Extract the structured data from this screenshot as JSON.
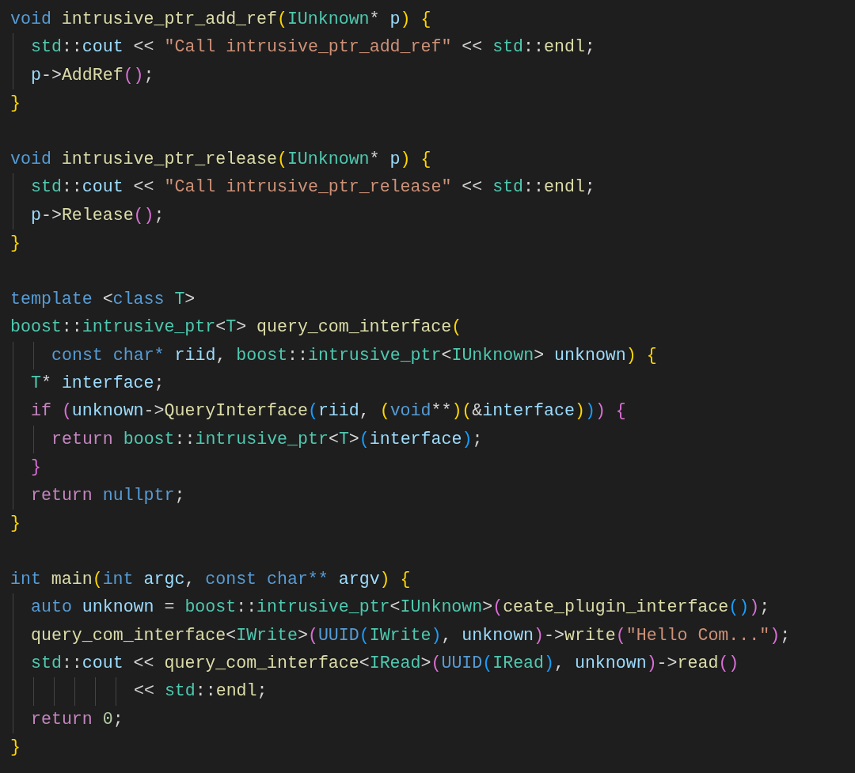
{
  "editor": {
    "lines": [
      {
        "kind": "code",
        "tokens": [
          {
            "text": "void ",
            "kind": "kw"
          },
          {
            "text": "intrusive_ptr_add_ref",
            "kind": "fn"
          },
          {
            "text": "(",
            "kind": "b1"
          },
          {
            "text": "IUnknown",
            "kind": "type"
          },
          {
            "text": "* ",
            "kind": "p"
          },
          {
            "text": "p",
            "kind": "var"
          },
          {
            "text": ") ",
            "kind": "b1"
          },
          {
            "text": "{",
            "kind": "b1"
          }
        ],
        "children": [
          {
            "kind": "code",
            "tokens": [
              {
                "text": "std",
                "kind": "type"
              },
              {
                "text": "::",
                "kind": "p"
              },
              {
                "text": "cout ",
                "kind": "var"
              },
              {
                "text": "<< ",
                "kind": "p"
              },
              {
                "text": "\"Call intrusive_ptr_add_ref\" ",
                "kind": "str"
              },
              {
                "text": "<< ",
                "kind": "p"
              },
              {
                "text": "std",
                "kind": "type"
              },
              {
                "text": "::",
                "kind": "p"
              },
              {
                "text": "endl",
                "kind": "fn"
              },
              {
                "text": ";",
                "kind": "p"
              }
            ]
          },
          {
            "kind": "code",
            "tokens": [
              {
                "text": "p",
                "kind": "var"
              },
              {
                "text": "->",
                "kind": "p"
              },
              {
                "text": "AddRef",
                "kind": "fn"
              },
              {
                "text": "()",
                "kind": "b2"
              },
              {
                "text": ";",
                "kind": "p"
              }
            ]
          }
        ]
      },
      {
        "kind": "code",
        "tokens": [
          {
            "text": "}",
            "kind": "b1"
          }
        ]
      },
      {
        "kind": "blank"
      },
      {
        "kind": "code",
        "tokens": [
          {
            "text": "void ",
            "kind": "kw"
          },
          {
            "text": "intrusive_ptr_release",
            "kind": "fn"
          },
          {
            "text": "(",
            "kind": "b1"
          },
          {
            "text": "IUnknown",
            "kind": "type"
          },
          {
            "text": "* ",
            "kind": "p"
          },
          {
            "text": "p",
            "kind": "var"
          },
          {
            "text": ") ",
            "kind": "b1"
          },
          {
            "text": "{",
            "kind": "b1"
          }
        ],
        "children": [
          {
            "kind": "code",
            "tokens": [
              {
                "text": "std",
                "kind": "type"
              },
              {
                "text": "::",
                "kind": "p"
              },
              {
                "text": "cout ",
                "kind": "var"
              },
              {
                "text": "<< ",
                "kind": "p"
              },
              {
                "text": "\"Call intrusive_ptr_release\" ",
                "kind": "str"
              },
              {
                "text": "<< ",
                "kind": "p"
              },
              {
                "text": "std",
                "kind": "type"
              },
              {
                "text": "::",
                "kind": "p"
              },
              {
                "text": "endl",
                "kind": "fn"
              },
              {
                "text": ";",
                "kind": "p"
              }
            ]
          },
          {
            "kind": "code",
            "tokens": [
              {
                "text": "p",
                "kind": "var"
              },
              {
                "text": "->",
                "kind": "p"
              },
              {
                "text": "Release",
                "kind": "fn"
              },
              {
                "text": "()",
                "kind": "b2"
              },
              {
                "text": ";",
                "kind": "p"
              }
            ]
          }
        ]
      },
      {
        "kind": "code",
        "tokens": [
          {
            "text": "}",
            "kind": "b1"
          }
        ]
      },
      {
        "kind": "blank"
      },
      {
        "kind": "code",
        "tokens": [
          {
            "text": "template ",
            "kind": "kw"
          },
          {
            "text": "<",
            "kind": "p"
          },
          {
            "text": "class ",
            "kind": "kw"
          },
          {
            "text": "T",
            "kind": "type"
          },
          {
            "text": ">",
            "kind": "p"
          }
        ]
      },
      {
        "kind": "code",
        "tokens": [
          {
            "text": "boost",
            "kind": "type"
          },
          {
            "text": "::",
            "kind": "p"
          },
          {
            "text": "intrusive_ptr",
            "kind": "type"
          },
          {
            "text": "<",
            "kind": "p"
          },
          {
            "text": "T",
            "kind": "type"
          },
          {
            "text": "> ",
            "kind": "p"
          },
          {
            "text": "query_com_interface",
            "kind": "fn"
          },
          {
            "text": "(",
            "kind": "b1"
          }
        ],
        "children": [
          {
            "kind": "group",
            "children": [
              {
                "kind": "code",
                "tokens": [
                  {
                    "text": "const ",
                    "kind": "kw"
                  },
                  {
                    "text": "char* ",
                    "kind": "kw"
                  },
                  {
                    "text": "riid",
                    "kind": "var"
                  },
                  {
                    "text": ", ",
                    "kind": "p"
                  },
                  {
                    "text": "boost",
                    "kind": "type"
                  },
                  {
                    "text": "::",
                    "kind": "p"
                  },
                  {
                    "text": "intrusive_ptr",
                    "kind": "type"
                  },
                  {
                    "text": "<",
                    "kind": "p"
                  },
                  {
                    "text": "IUnknown",
                    "kind": "type"
                  },
                  {
                    "text": "> ",
                    "kind": "p"
                  },
                  {
                    "text": "unknown",
                    "kind": "var"
                  },
                  {
                    "text": ") ",
                    "kind": "b1"
                  },
                  {
                    "text": "{",
                    "kind": "b1"
                  }
                ]
              }
            ]
          },
          {
            "kind": "code",
            "tokens": [
              {
                "text": "T",
                "kind": "type"
              },
              {
                "text": "* ",
                "kind": "p"
              },
              {
                "text": "interface",
                "kind": "var"
              },
              {
                "text": ";",
                "kind": "p"
              }
            ]
          },
          {
            "kind": "code",
            "tokens": [
              {
                "text": "if ",
                "kind": "ctl"
              },
              {
                "text": "(",
                "kind": "b2"
              },
              {
                "text": "unknown",
                "kind": "var"
              },
              {
                "text": "->",
                "kind": "p"
              },
              {
                "text": "QueryInterface",
                "kind": "fn"
              },
              {
                "text": "(",
                "kind": "b3"
              },
              {
                "text": "riid",
                "kind": "var"
              },
              {
                "text": ", ",
                "kind": "p"
              },
              {
                "text": "(",
                "kind": "b1"
              },
              {
                "text": "void",
                "kind": "kw"
              },
              {
                "text": "**",
                "kind": "p"
              },
              {
                "text": ")",
                "kind": "b1"
              },
              {
                "text": "(",
                "kind": "b1"
              },
              {
                "text": "&",
                "kind": "p"
              },
              {
                "text": "interface",
                "kind": "var"
              },
              {
                "text": ")",
                "kind": "b1"
              },
              {
                "text": ")",
                "kind": "b3"
              },
              {
                "text": ") ",
                "kind": "b2"
              },
              {
                "text": "{",
                "kind": "b2"
              }
            ],
            "children": [
              {
                "kind": "code",
                "tokens": [
                  {
                    "text": "return ",
                    "kind": "ctl"
                  },
                  {
                    "text": "boost",
                    "kind": "type"
                  },
                  {
                    "text": "::",
                    "kind": "p"
                  },
                  {
                    "text": "intrusive_ptr",
                    "kind": "type"
                  },
                  {
                    "text": "<",
                    "kind": "p"
                  },
                  {
                    "text": "T",
                    "kind": "type"
                  },
                  {
                    "text": ">",
                    "kind": "p"
                  },
                  {
                    "text": "(",
                    "kind": "b3"
                  },
                  {
                    "text": "interface",
                    "kind": "var"
                  },
                  {
                    "text": ")",
                    "kind": "b3"
                  },
                  {
                    "text": ";",
                    "kind": "p"
                  }
                ]
              }
            ]
          },
          {
            "kind": "code",
            "tokens": [
              {
                "text": "}",
                "kind": "b2"
              }
            ]
          },
          {
            "kind": "code",
            "tokens": [
              {
                "text": "return ",
                "kind": "ctl"
              },
              {
                "text": "nullptr",
                "kind": "kw"
              },
              {
                "text": ";",
                "kind": "p"
              }
            ]
          }
        ]
      },
      {
        "kind": "code",
        "tokens": [
          {
            "text": "}",
            "kind": "b1"
          }
        ]
      },
      {
        "kind": "blank"
      },
      {
        "kind": "code",
        "tokens": [
          {
            "text": "int ",
            "kind": "kw"
          },
          {
            "text": "main",
            "kind": "fn"
          },
          {
            "text": "(",
            "kind": "b1"
          },
          {
            "text": "int ",
            "kind": "kw"
          },
          {
            "text": "argc",
            "kind": "var"
          },
          {
            "text": ", ",
            "kind": "p"
          },
          {
            "text": "const ",
            "kind": "kw"
          },
          {
            "text": "char** ",
            "kind": "kw"
          },
          {
            "text": "argv",
            "kind": "var"
          },
          {
            "text": ") ",
            "kind": "b1"
          },
          {
            "text": "{",
            "kind": "b1"
          }
        ],
        "children": [
          {
            "kind": "code",
            "tokens": [
              {
                "text": "auto ",
                "kind": "kw"
              },
              {
                "text": "unknown ",
                "kind": "var"
              },
              {
                "text": "= ",
                "kind": "p"
              },
              {
                "text": "boost",
                "kind": "type"
              },
              {
                "text": "::",
                "kind": "p"
              },
              {
                "text": "intrusive_ptr",
                "kind": "type"
              },
              {
                "text": "<",
                "kind": "p"
              },
              {
                "text": "IUnknown",
                "kind": "type"
              },
              {
                "text": ">",
                "kind": "p"
              },
              {
                "text": "(",
                "kind": "b2"
              },
              {
                "text": "ceate_plugin_interface",
                "kind": "fn"
              },
              {
                "text": "()",
                "kind": "b3"
              },
              {
                "text": ")",
                "kind": "b2"
              },
              {
                "text": ";",
                "kind": "p"
              }
            ]
          },
          {
            "kind": "code",
            "tokens": [
              {
                "text": "query_com_interface",
                "kind": "fn"
              },
              {
                "text": "<",
                "kind": "p"
              },
              {
                "text": "IWrite",
                "kind": "type"
              },
              {
                "text": ">",
                "kind": "p"
              },
              {
                "text": "(",
                "kind": "b2"
              },
              {
                "text": "UUID",
                "kind": "kw"
              },
              {
                "text": "(",
                "kind": "b3"
              },
              {
                "text": "IWrite",
                "kind": "type"
              },
              {
                "text": ")",
                "kind": "b3"
              },
              {
                "text": ", ",
                "kind": "p"
              },
              {
                "text": "unknown",
                "kind": "var"
              },
              {
                "text": ")",
                "kind": "b2"
              },
              {
                "text": "->",
                "kind": "p"
              },
              {
                "text": "write",
                "kind": "fn"
              },
              {
                "text": "(",
                "kind": "b2"
              },
              {
                "text": "\"Hello Com...\"",
                "kind": "str"
              },
              {
                "text": ")",
                "kind": "b2"
              },
              {
                "text": ";",
                "kind": "p"
              }
            ]
          },
          {
            "kind": "code",
            "tokens": [
              {
                "text": "std",
                "kind": "type"
              },
              {
                "text": "::",
                "kind": "p"
              },
              {
                "text": "cout ",
                "kind": "var"
              },
              {
                "text": "<< ",
                "kind": "p"
              },
              {
                "text": "query_com_interface",
                "kind": "fn"
              },
              {
                "text": "<",
                "kind": "p"
              },
              {
                "text": "IRead",
                "kind": "type"
              },
              {
                "text": ">",
                "kind": "p"
              },
              {
                "text": "(",
                "kind": "b2"
              },
              {
                "text": "UUID",
                "kind": "kw"
              },
              {
                "text": "(",
                "kind": "b3"
              },
              {
                "text": "IRead",
                "kind": "type"
              },
              {
                "text": ")",
                "kind": "b3"
              },
              {
                "text": ", ",
                "kind": "p"
              },
              {
                "text": "unknown",
                "kind": "var"
              },
              {
                "text": ")",
                "kind": "b2"
              },
              {
                "text": "->",
                "kind": "p"
              },
              {
                "text": "read",
                "kind": "fn"
              },
              {
                "text": "()",
                "kind": "b2"
              }
            ],
            "children": [
              {
                "kind": "group",
                "children": [
                  {
                    "kind": "group",
                    "children": [
                      {
                        "kind": "group",
                        "children": [
                          {
                            "kind": "group",
                            "children": [
                              {
                                "kind": "code",
                                "tokens": [
                                  {
                                    "text": "<< ",
                                    "kind": "p"
                                  },
                                  {
                                    "text": "std",
                                    "kind": "type"
                                  },
                                  {
                                    "text": "::",
                                    "kind": "p"
                                  },
                                  {
                                    "text": "endl",
                                    "kind": "fn"
                                  },
                                  {
                                    "text": ";",
                                    "kind": "p"
                                  }
                                ]
                              }
                            ]
                          }
                        ]
                      }
                    ]
                  }
                ]
              }
            ]
          },
          {
            "kind": "code",
            "tokens": [
              {
                "text": "return ",
                "kind": "ctl"
              },
              {
                "text": "0",
                "kind": "num"
              },
              {
                "text": ";",
                "kind": "p"
              }
            ]
          }
        ]
      },
      {
        "kind": "code",
        "tokens": [
          {
            "text": "}",
            "kind": "b1"
          }
        ]
      }
    ]
  }
}
